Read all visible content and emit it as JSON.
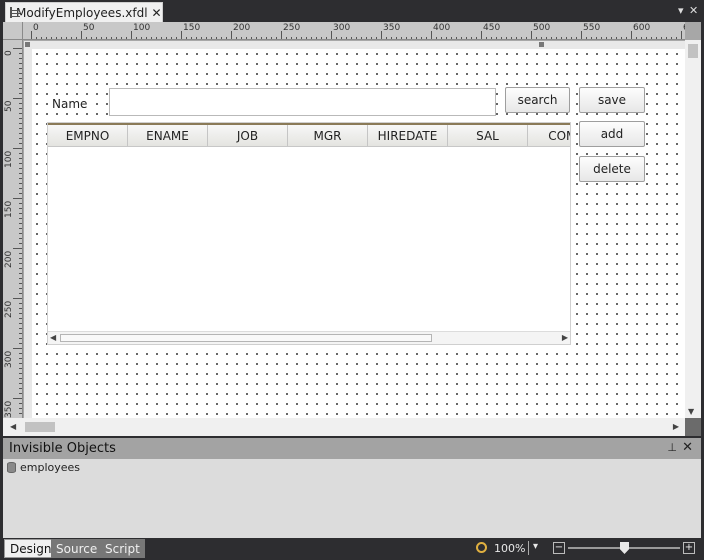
{
  "document_tab": {
    "title": "ModifyEmployees.xfdl",
    "close": "✕"
  },
  "strip_controls": {
    "menu": "▾",
    "close": "✕"
  },
  "ruler": {
    "h_labels": [
      "0",
      "50",
      "100",
      "150",
      "200",
      "250",
      "300",
      "350",
      "400",
      "450",
      "500",
      "550",
      "600",
      "6"
    ],
    "v_labels": [
      "0",
      "50",
      "100",
      "150",
      "200",
      "250",
      "300",
      "350"
    ]
  },
  "form": {
    "name_label": "Name",
    "name_input_value": "",
    "search_button": "search",
    "save_button": "save",
    "add_button": "add",
    "delete_button": "delete",
    "grid_columns": [
      "EMPNO",
      "ENAME",
      "JOB",
      "MGR",
      "HIREDATE",
      "SAL",
      "COMM"
    ]
  },
  "invisible_objects": {
    "title": "Invisible Objects",
    "pin": "⊥",
    "close": "✕",
    "items": [
      {
        "label": "employees",
        "icon": "database-icon"
      }
    ]
  },
  "view_tabs": [
    {
      "label": "Design",
      "active": true
    },
    {
      "label": "Source",
      "active": false
    },
    {
      "label": "Script",
      "active": false
    }
  ],
  "zoom": {
    "label": "100%",
    "caret": "▾",
    "minus": "−",
    "plus": "+",
    "level": 0.5
  }
}
